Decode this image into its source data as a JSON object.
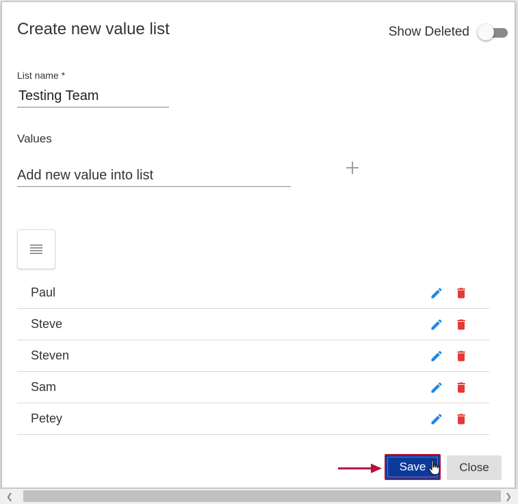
{
  "dialog": {
    "title": "Create new value list",
    "show_deleted_label": "Show Deleted",
    "show_deleted_on": false
  },
  "form": {
    "list_name_label": "List name *",
    "list_name_value": "Testing Team",
    "values_label": "Values",
    "new_value_placeholder": "Add new value into list"
  },
  "icons": {
    "add": "plus-icon",
    "reorder": "reorder-icon",
    "edit": "pencil-icon",
    "delete": "trash-icon",
    "arrow": "arrow-right-icon",
    "cursor": "hand-cursor-icon"
  },
  "values": [
    {
      "label": "Paul"
    },
    {
      "label": "Steve"
    },
    {
      "label": "Steven"
    },
    {
      "label": "Sam"
    },
    {
      "label": "Petey"
    }
  ],
  "footer": {
    "save_label": "Save",
    "close_label": "Close"
  },
  "colors": {
    "primary": "#0c3a9a",
    "edit_icon": "#1e88e5",
    "delete_icon": "#e53935",
    "highlight": "#b0123b"
  }
}
